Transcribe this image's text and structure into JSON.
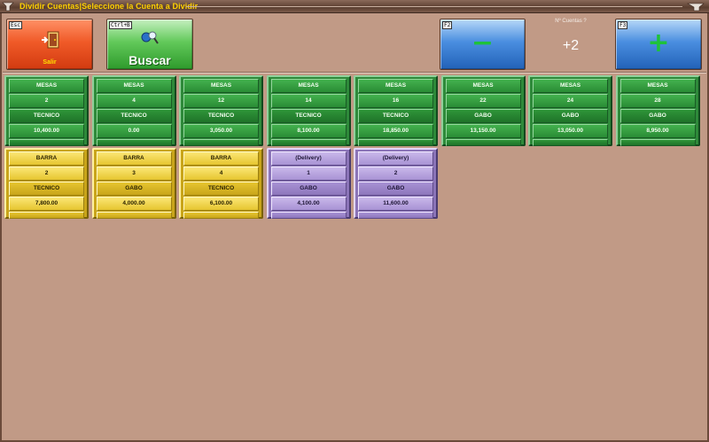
{
  "window": {
    "title": "Dividir Cuentas|Seleccione la Cuenta a Dividir"
  },
  "toolbar": {
    "salir": {
      "key": "Esc",
      "label": "Salir",
      "icon": "exit-door-icon"
    },
    "buscar": {
      "key": "Ctrl+B",
      "label": "Buscar",
      "icon": "search-magnifier-icon"
    },
    "minus": {
      "key": "F2",
      "symbol": "−"
    },
    "plus": {
      "key": "F3",
      "symbol": "+"
    },
    "count_label": "Nº Cuentas ?",
    "count_value": "+2"
  },
  "colors": {
    "background": "#c19a86",
    "title_text": "#ffd200",
    "mesa": "#2e8a3a",
    "barra": "#e6c530",
    "delivery": "#a892d4"
  },
  "accounts_row1": [
    {
      "type": "MESAS",
      "number": "2",
      "user": "TECNICO",
      "amount": "10,400.00"
    },
    {
      "type": "MESAS",
      "number": "4",
      "user": "TECNICO",
      "amount": "0.00"
    },
    {
      "type": "MESAS",
      "number": "12",
      "user": "TECNICO",
      "amount": "3,050.00"
    },
    {
      "type": "MESAS",
      "number": "14",
      "user": "TECNICO",
      "amount": "8,100.00"
    },
    {
      "type": "MESAS",
      "number": "16",
      "user": "TECNICO",
      "amount": "18,850.00"
    },
    {
      "type": "MESAS",
      "number": "22",
      "user": "GABO",
      "amount": "13,150.00"
    },
    {
      "type": "MESAS",
      "number": "24",
      "user": "GABO",
      "amount": "13,050.00"
    },
    {
      "type": "MESAS",
      "number": "28",
      "user": "GABO",
      "amount": "8,950.00"
    }
  ],
  "accounts_row2": [
    {
      "type": "BARRA",
      "number": "2",
      "user": "TECNICO",
      "amount": "7,800.00"
    },
    {
      "type": "BARRA",
      "number": "3",
      "user": "GABO",
      "amount": "4,000.00"
    },
    {
      "type": "BARRA",
      "number": "4",
      "user": "TECNICO",
      "amount": "6,100.00"
    },
    {
      "type": "(Delivery)",
      "number": "1",
      "user": "GABO",
      "amount": "4,100.00"
    },
    {
      "type": "(Delivery)",
      "number": "2",
      "user": "GABO",
      "amount": "11,600.00"
    }
  ]
}
